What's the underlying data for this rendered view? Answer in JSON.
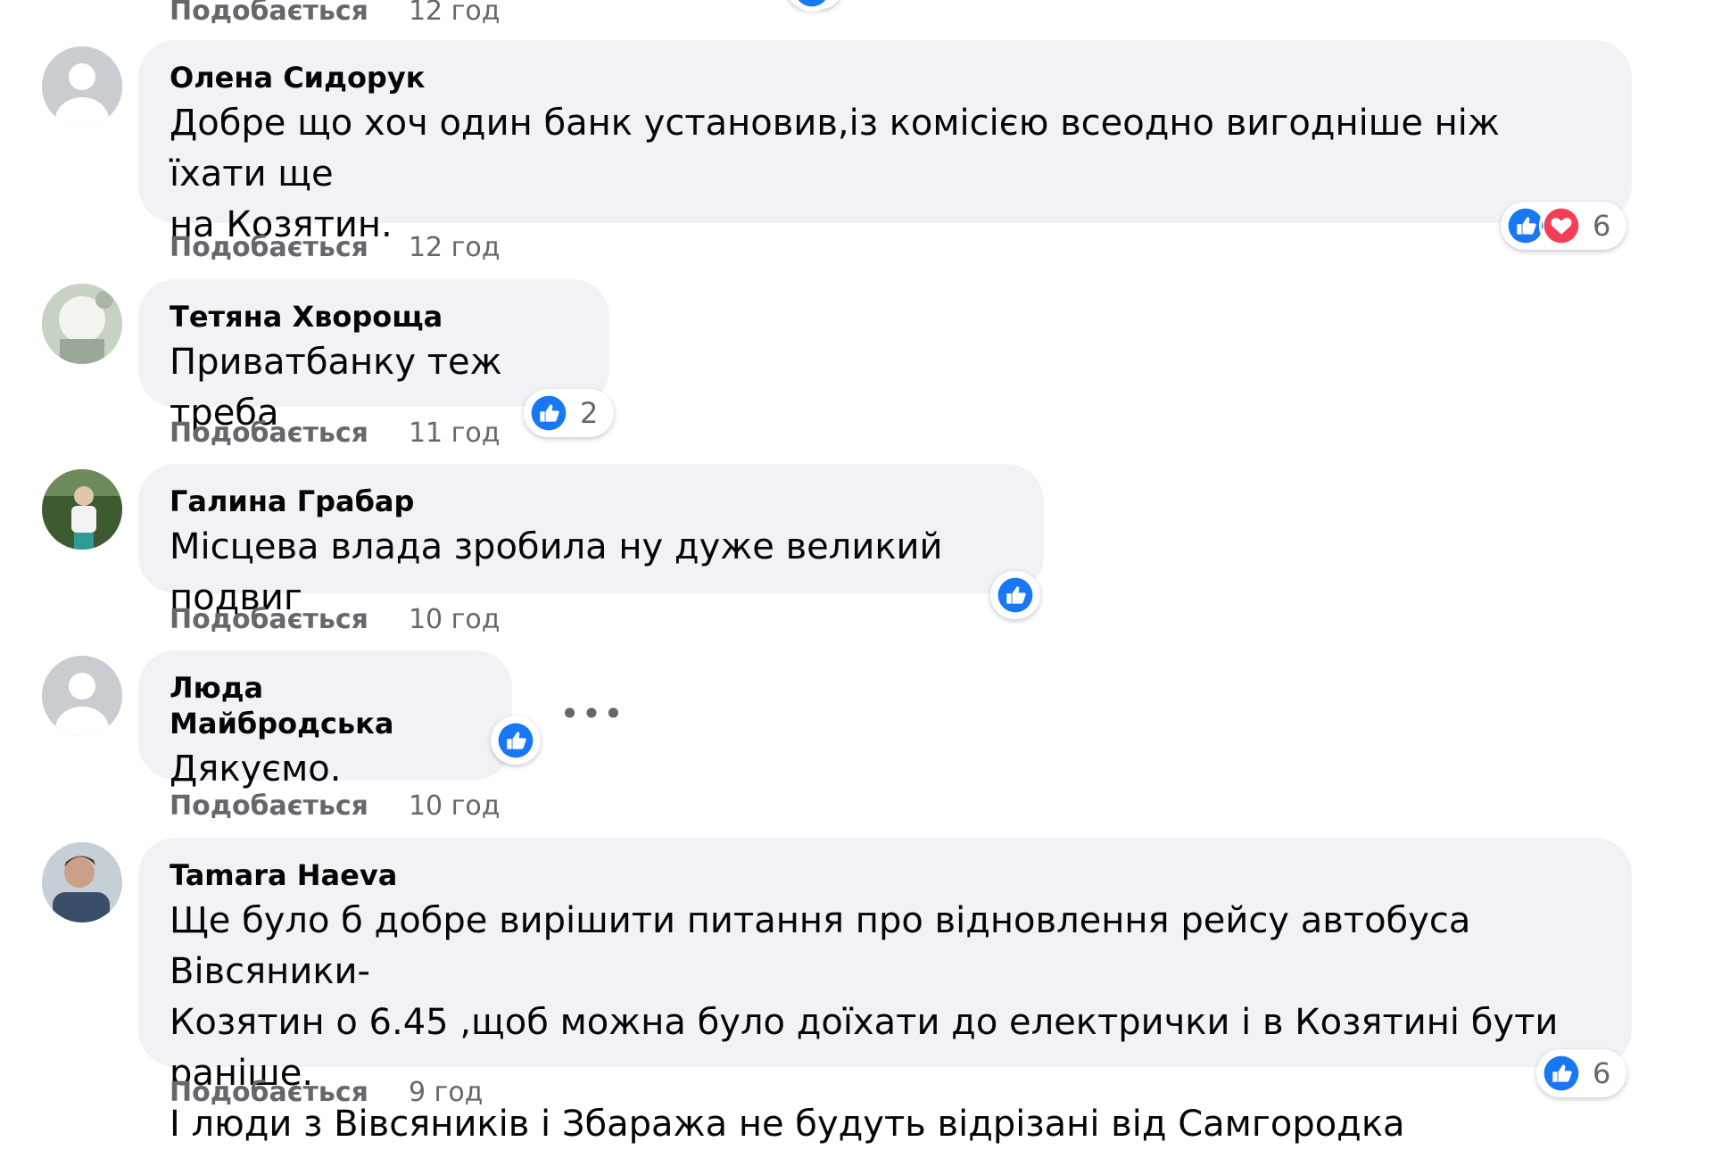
{
  "like_label": "Подобається",
  "colors": {
    "like_blue": "#1877f2",
    "heart_red": "#f33e58",
    "bubble_bg": "#f0f2f5",
    "meta_gray": "#65676b"
  },
  "comments": [
    {
      "time": "12 год"
    },
    {
      "author": "Олена Сидорук",
      "text_lines": [
        "Добре що хоч один банк установив,із комісією всеодно вигодніше ніж їхати ще",
        "на Козятин."
      ],
      "time": "12 год",
      "reactions": [
        "like",
        "love"
      ],
      "count": "6"
    },
    {
      "author": "Тетяна Хвороща",
      "text_lines": [
        "Приватбанку теж треба"
      ],
      "time": "11 год",
      "reactions": [
        "like"
      ],
      "count": "2"
    },
    {
      "author": "Галина Грабар",
      "text_lines": [
        "Місцева влада зробила ну дуже великий подвиг"
      ],
      "time": "10 год",
      "reactions": [
        "like"
      ]
    },
    {
      "author": "Люда Майбродська",
      "text_lines": [
        "Дякуємо."
      ],
      "time": "10 год",
      "reactions": [
        "like"
      ],
      "more_label": "•••"
    },
    {
      "author": "Tamara Haeva",
      "text_lines": [
        "Ще було б добре вирішити питання про відновлення рейсу автобуса Вівсяники-",
        "Козятин о 6.45 ,щоб можна було доїхати до електрички і в Козятині бути раніше.",
        "І люди з Вівсяників і Збаража не будуть відрізані від Самгородка"
      ],
      "time": "9 год",
      "reactions": [
        "like"
      ],
      "count": "6"
    }
  ]
}
